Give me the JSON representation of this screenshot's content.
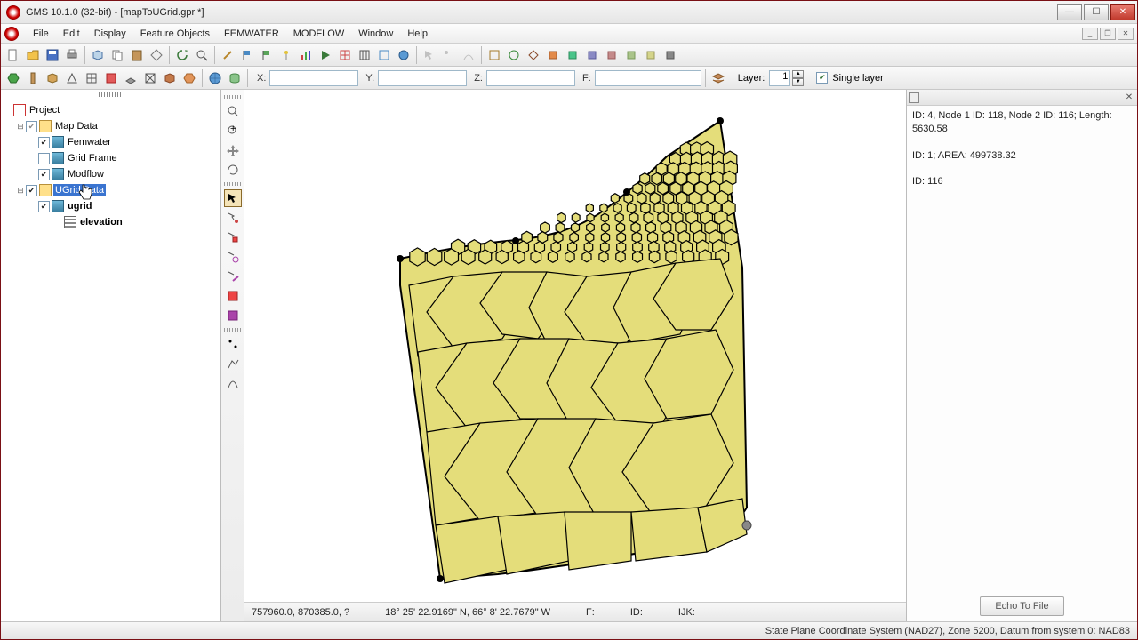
{
  "title": "GMS 10.1.0 (32-bit) - [mapToUGrid.gpr *]",
  "menu": [
    "File",
    "Edit",
    "Display",
    "Feature Objects",
    "FEMWATER",
    "MODFLOW",
    "Window",
    "Help"
  ],
  "coords": {
    "x_label": "X:",
    "y_label": "Y:",
    "z_label": "Z:",
    "f_label": "F:"
  },
  "layer": {
    "label": "Layer:",
    "value": "1",
    "single_label": "Single layer"
  },
  "tree": {
    "project": "Project",
    "mapdata": "Map Data",
    "femwater": "Femwater",
    "gridframe": "Grid Frame",
    "modflow": "Modflow",
    "ugriddata": "UGrid Data",
    "ugrid": "ugrid",
    "elevation": "elevation"
  },
  "info": {
    "line1": "ID: 4, Node 1 ID: 118, Node 2 ID: 116; Length: 5630.58",
    "line2": "ID: 1; AREA: 499738.32",
    "line3": "ID: 116",
    "echo_btn": "Echo To File"
  },
  "canvas_status": {
    "xy": "757960.0, 870385.0, ?",
    "latlon": "18° 25' 22.9169\" N, 66° 8' 22.7679\" W",
    "f": "F:",
    "id": "ID:",
    "ijk": "IJK:"
  },
  "statusbar": "State Plane Coordinate System (NAD27),  Zone 5200,  Datum from system 0: NAD83"
}
